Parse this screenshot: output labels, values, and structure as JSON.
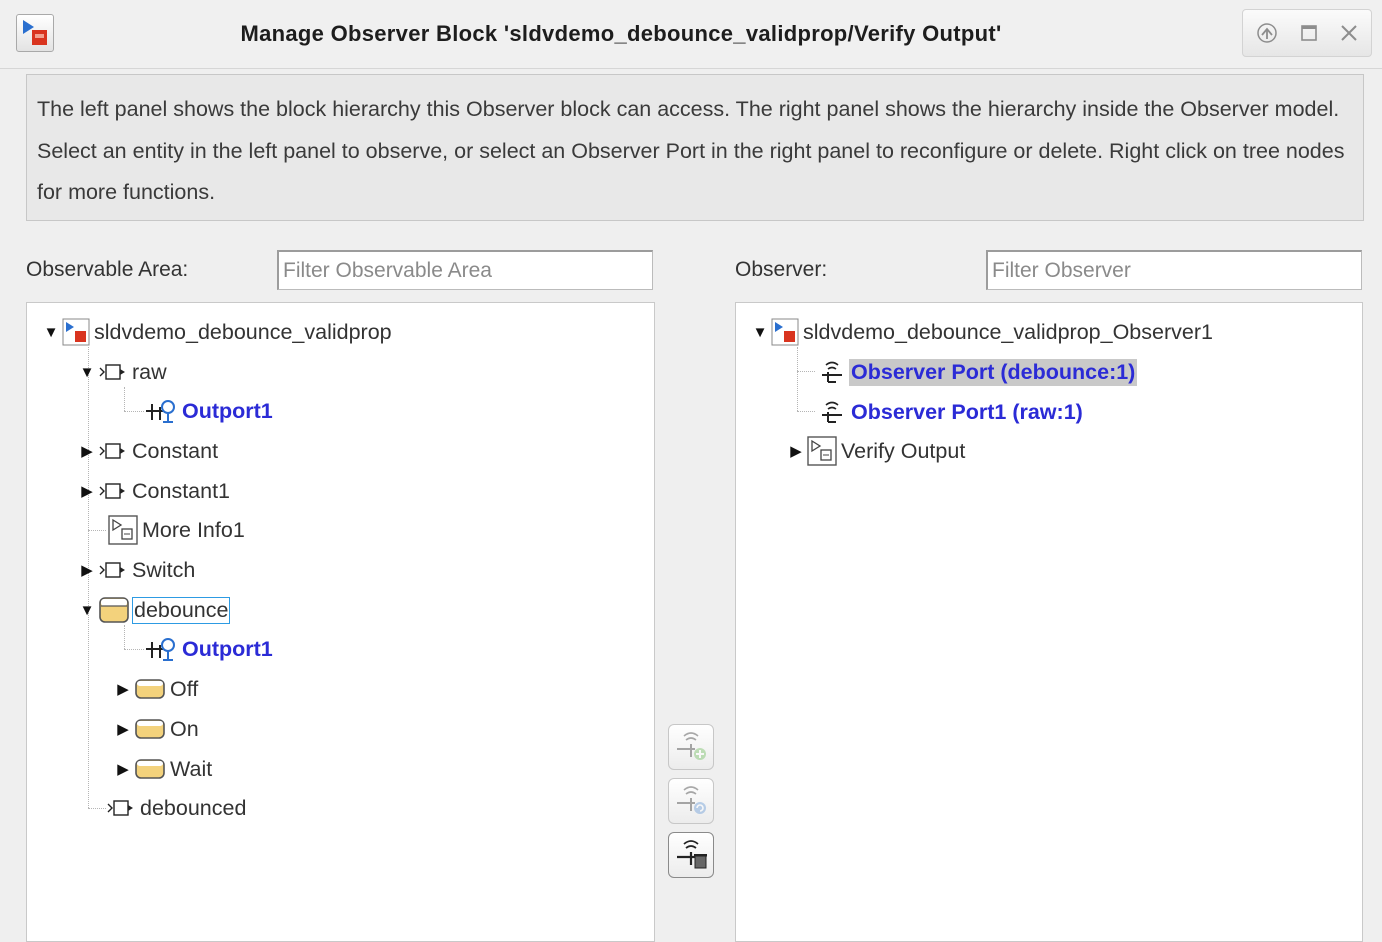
{
  "window": {
    "title": "Manage Observer Block 'sldvdemo_debounce_validprop/Verify Output'"
  },
  "description": "The left panel shows the block hierarchy this Observer block can access. The right panel shows the hierarchy inside the Observer model. Select an entity in the left panel to observe, or select an Observer Port in the right panel to reconfigure or delete. Right click on tree nodes for more functions.",
  "left": {
    "label": "Observable Area:",
    "filter_placeholder": "Filter Observable Area",
    "tree": [
      {
        "label": "sldvdemo_debounce_validprop",
        "icon": "model-icon",
        "expanded": true
      },
      {
        "label": "raw",
        "icon": "inport-block-icon",
        "expanded": true
      },
      {
        "label": "Outport1",
        "icon": "observed-port-icon"
      },
      {
        "label": "Constant",
        "icon": "inport-block-icon",
        "expanded": false
      },
      {
        "label": "Constant1",
        "icon": "inport-block-icon",
        "expanded": false
      },
      {
        "label": "More Info1",
        "icon": "subsystem-icon"
      },
      {
        "label": "Switch",
        "icon": "inport-block-icon",
        "expanded": false
      },
      {
        "label": "debounce",
        "icon": "stateflow-chart-icon",
        "expanded": true,
        "focused": true
      },
      {
        "label": "Outport1",
        "icon": "observed-port-icon"
      },
      {
        "label": "Off",
        "icon": "stateflow-state-icon",
        "expanded": false
      },
      {
        "label": "On",
        "icon": "stateflow-state-icon",
        "expanded": false
      },
      {
        "label": "Wait",
        "icon": "stateflow-state-icon",
        "expanded": false
      },
      {
        "label": "debounced",
        "icon": "outport-block-icon"
      }
    ]
  },
  "right": {
    "label": "Observer:",
    "filter_placeholder": "Filter Observer",
    "tree": [
      {
        "label": "sldvdemo_debounce_validprop_Observer1",
        "icon": "model-icon",
        "expanded": true
      },
      {
        "label": "Observer Port (debounce:1)",
        "icon": "observer-port-icon",
        "selected": true
      },
      {
        "label": "Observer Port1 (raw:1)",
        "icon": "observer-port-icon"
      },
      {
        "label": "Verify Output",
        "icon": "subsystem-icon",
        "expanded": false
      }
    ]
  },
  "side_buttons": [
    {
      "name": "add-observer-port-icon",
      "enabled": false
    },
    {
      "name": "reconfigure-observer-port-icon",
      "enabled": false
    },
    {
      "name": "delete-observer-port-icon",
      "enabled": true
    }
  ],
  "colors": {
    "port_link": "#2b2bd6",
    "selection": "#c9c9c9",
    "focus_border": "#2d9be3"
  }
}
